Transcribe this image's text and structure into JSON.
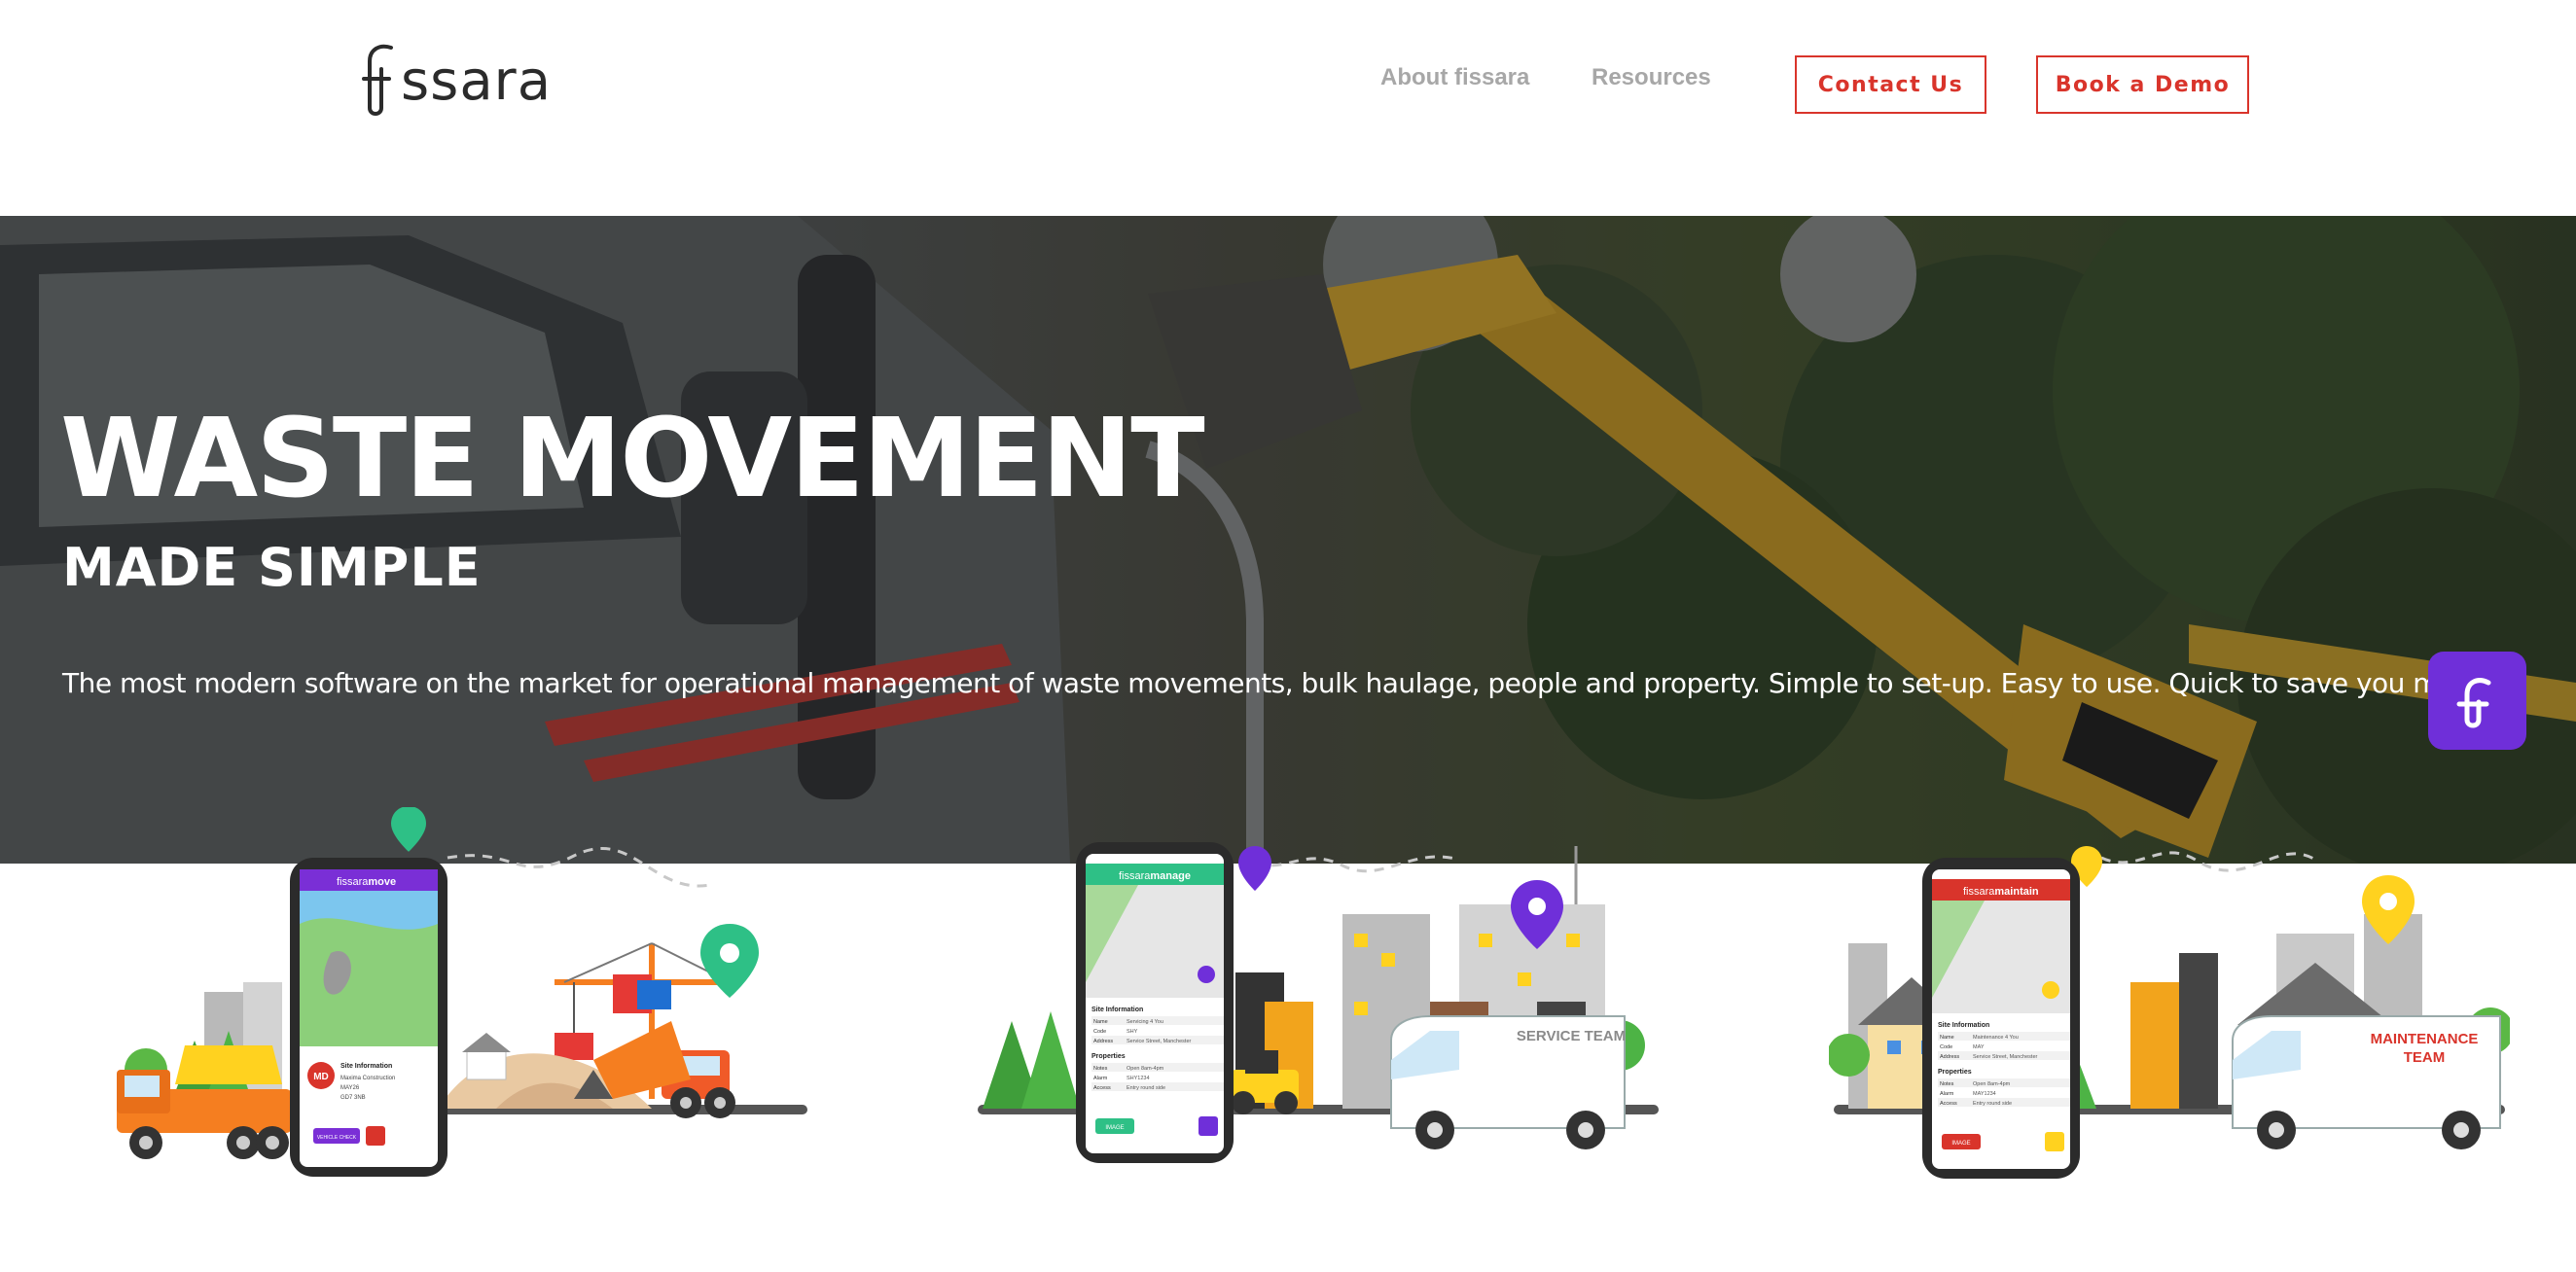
{
  "header": {
    "logo_text": "ssara",
    "nav": {
      "about": "About fissara",
      "resources": "Resources"
    },
    "contact_button": "Contact Us",
    "demo_button": "Book a Demo"
  },
  "hero": {
    "title": "WASTE MOVEMENT",
    "subtitle": "MADE SIMPLE",
    "description": "The most modern software on the market for operational management of waste movements, bulk haulage, people and property. Simple to set-up. Easy to use. Quick to save you money."
  },
  "apps": {
    "move": {
      "brand_prefix": "fissara",
      "brand_suffix": "move",
      "color": "#7a2fd6",
      "avatar_initials": "MD",
      "site_info_title": "Site Information",
      "lines": [
        "Maxima Construction",
        "MAY26",
        "GD7 3NB"
      ],
      "action_label": "VEHICLE CHECK"
    },
    "manage": {
      "brand_prefix": "fissara",
      "brand_suffix": "manage",
      "color": "#2ec086",
      "site_info_title": "Site Information",
      "rows": [
        {
          "k": "Name",
          "v": "Servicing 4 You"
        },
        {
          "k": "Code",
          "v": "SHY"
        },
        {
          "k": "Address",
          "v": "Service Street, Manchester"
        }
      ],
      "properties_title": "Properties",
      "props": [
        {
          "k": "Notes",
          "v": "Open 8am-4pm"
        },
        {
          "k": "Alarm",
          "v": "SHY1234"
        },
        {
          "k": "Access",
          "v": "Entry round side"
        }
      ],
      "action_label": "IMAGE",
      "van_label": "SERVICE TEAM"
    },
    "maintain": {
      "brand_prefix": "fissara",
      "brand_suffix": "maintain",
      "color": "#d9342b",
      "site_info_title": "Site Information",
      "rows": [
        {
          "k": "Name",
          "v": "Maintenance 4 You"
        },
        {
          "k": "Code",
          "v": "MAY"
        },
        {
          "k": "Address",
          "v": "Service Street, Manchester"
        }
      ],
      "properties_title": "Properties",
      "props": [
        {
          "k": "Notes",
          "v": "Open 8am-4pm"
        },
        {
          "k": "Alarm",
          "v": "MAY1234"
        },
        {
          "k": "Access",
          "v": "Entry round side"
        }
      ],
      "action_label": "IMAGE",
      "van_label_1": "MAINTENANCE",
      "van_label_2": "TEAM"
    }
  },
  "colors": {
    "accent_red": "#d9342b",
    "brand_purple": "#6f2fd9",
    "nav_grey": "#a7a7a7"
  }
}
